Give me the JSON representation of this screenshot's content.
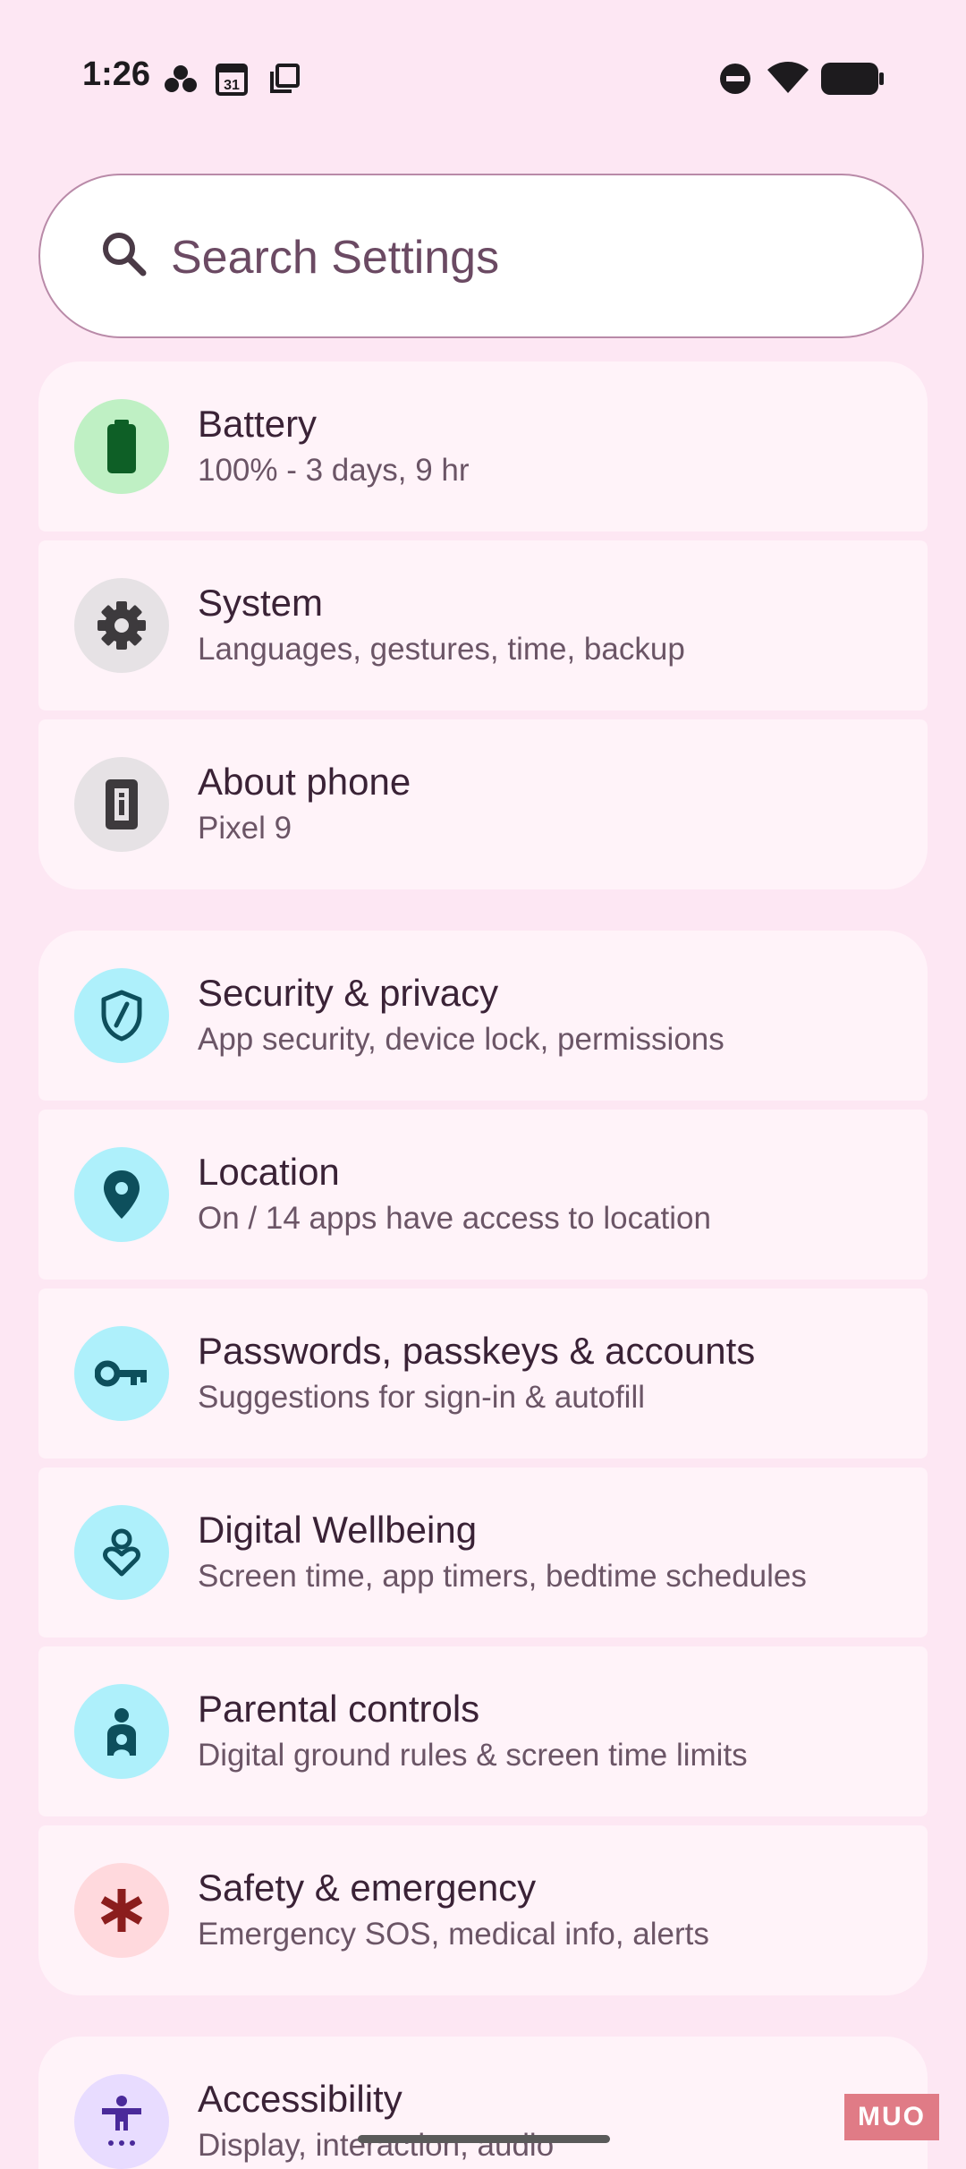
{
  "status_bar": {
    "time": "1:26",
    "calendar_day": "31",
    "left_icons": [
      "dots-icon",
      "calendar-icon",
      "copy-icon"
    ],
    "right_icons": [
      "dnd-icon",
      "wifi-icon",
      "battery-icon"
    ]
  },
  "search": {
    "placeholder": "Search Settings"
  },
  "groups": [
    {
      "items": [
        {
          "title": "Battery",
          "subtitle": "100% - 3 days, 9 hr",
          "icon": "battery-icon"
        },
        {
          "title": "System",
          "subtitle": "Languages, gestures, time, backup",
          "icon": "gear-icon"
        },
        {
          "title": "About phone",
          "subtitle": "Pixel 9",
          "icon": "phone-info-icon"
        }
      ]
    },
    {
      "items": [
        {
          "title": "Security & privacy",
          "subtitle": "App security, device lock, permissions",
          "icon": "shield-icon"
        },
        {
          "title": "Location",
          "subtitle": "On / 14 apps have access to location",
          "icon": "location-pin-icon"
        },
        {
          "title": "Passwords, passkeys & accounts",
          "subtitle": "Suggestions for sign-in & autofill",
          "icon": "key-icon"
        },
        {
          "title": "Digital Wellbeing",
          "subtitle": "Screen time, app timers, bedtime schedules",
          "icon": "wellbeing-icon"
        },
        {
          "title": "Parental controls",
          "subtitle": "Digital ground rules & screen time limits",
          "icon": "parental-icon"
        },
        {
          "title": "Safety & emergency",
          "subtitle": "Emergency SOS, medical info, alerts",
          "icon": "asterisk-icon"
        }
      ]
    },
    {
      "items": [
        {
          "title": "Accessibility",
          "subtitle": "Display, interaction, audio",
          "icon": "accessibility-icon"
        }
      ]
    }
  ],
  "watermark": "MUO",
  "colors": {
    "background": "#fde7f3",
    "card": "#fff3f9",
    "green_badge": "#bff0c4",
    "cyan_badge": "#aef0fb",
    "grey_badge": "#e6e2e5",
    "pink_badge": "#ffd9dd",
    "lavender_badge": "#e8dcff"
  }
}
